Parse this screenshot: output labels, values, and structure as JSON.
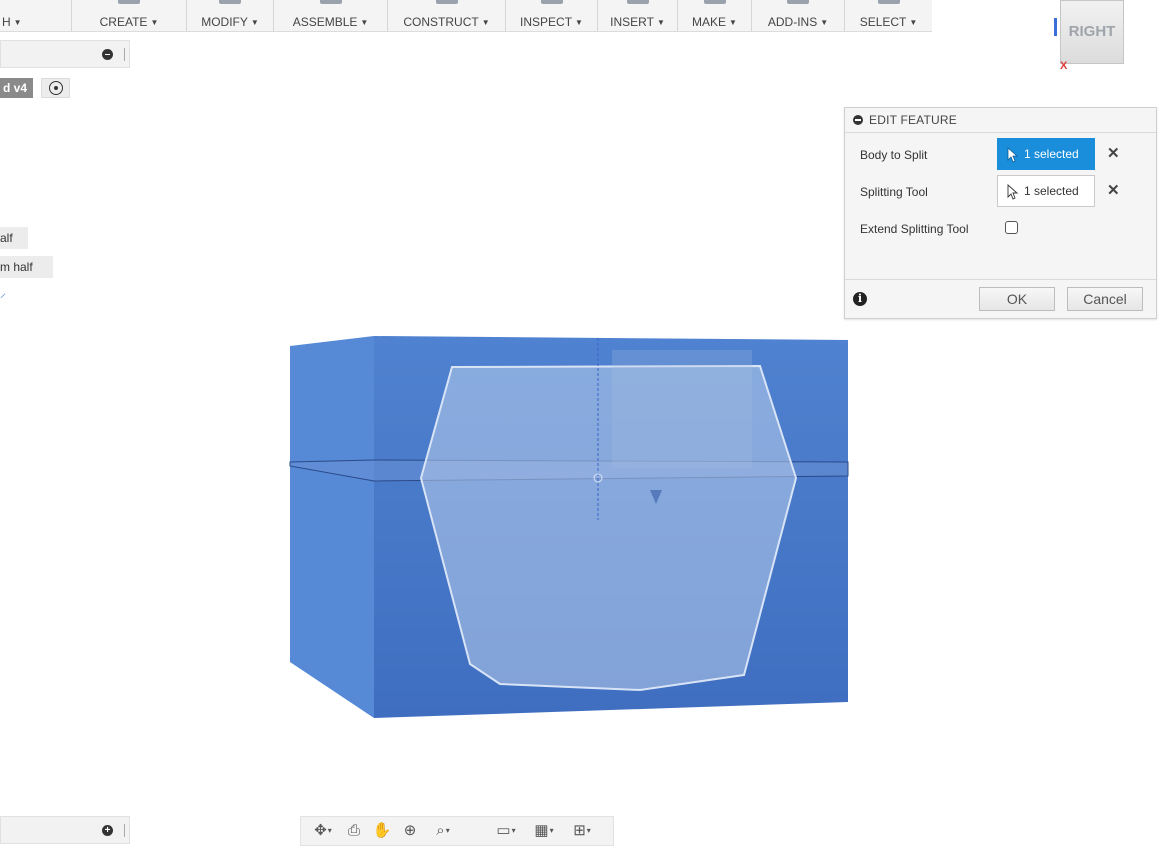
{
  "toolbar": {
    "menus": [
      {
        "label": "H"
      },
      {
        "label": "CREATE"
      },
      {
        "label": "MODIFY"
      },
      {
        "label": "ASSEMBLE"
      },
      {
        "label": "CONSTRUCT"
      },
      {
        "label": "INSPECT"
      },
      {
        "label": "INSERT"
      },
      {
        "label": "MAKE"
      },
      {
        "label": "ADD-INS"
      },
      {
        "label": "SELECT"
      }
    ],
    "caret": "▼"
  },
  "browser": {
    "top_strip_icon": "minus-circle-icon",
    "document_tag": "d v4",
    "bodies": [
      {
        "label": "alf"
      },
      {
        "label": "m half"
      }
    ],
    "bottom_strip_icon": "plus-circle-icon",
    "plus_glyph": "+"
  },
  "viewcube": {
    "face_label": "RIGHT",
    "axis_label": "X"
  },
  "edit_feature": {
    "title": "EDIT FEATURE",
    "fields": {
      "body_to_split": {
        "label": "Body to Split",
        "value": "1 selected",
        "state": "active"
      },
      "splitting_tool": {
        "label": "Splitting Tool",
        "value": "1 selected",
        "state": "inactive"
      },
      "extend_splitting_tool": {
        "label": "Extend Splitting Tool",
        "checked": false
      }
    },
    "clear_glyph": "✕",
    "ok_label": "OK",
    "cancel_label": "Cancel",
    "info_glyph": "i",
    "accent_color": "#1a8ddb"
  },
  "model": {
    "body_color": "#4a7fcf",
    "split_face_color": "#8fb0e0"
  },
  "navbar": {
    "tools": [
      {
        "icon": "orbit-icon",
        "glyph": "✥",
        "has_caret": true
      },
      {
        "icon": "look-at-icon",
        "glyph": "⎙",
        "has_caret": false
      },
      {
        "icon": "pan-hand-icon",
        "glyph": "✋",
        "has_caret": false
      },
      {
        "icon": "zoom-icon",
        "glyph": "⊕",
        "has_caret": false
      },
      {
        "icon": "zoom-window-icon",
        "glyph": "⌕",
        "has_caret": true
      },
      {
        "icon": "display-settings-icon",
        "glyph": "▭",
        "has_caret": true
      },
      {
        "icon": "grid-icon",
        "glyph": "▦",
        "has_caret": true
      },
      {
        "icon": "viewports-icon",
        "glyph": "⊞",
        "has_caret": true
      }
    ],
    "caret": "▾"
  }
}
